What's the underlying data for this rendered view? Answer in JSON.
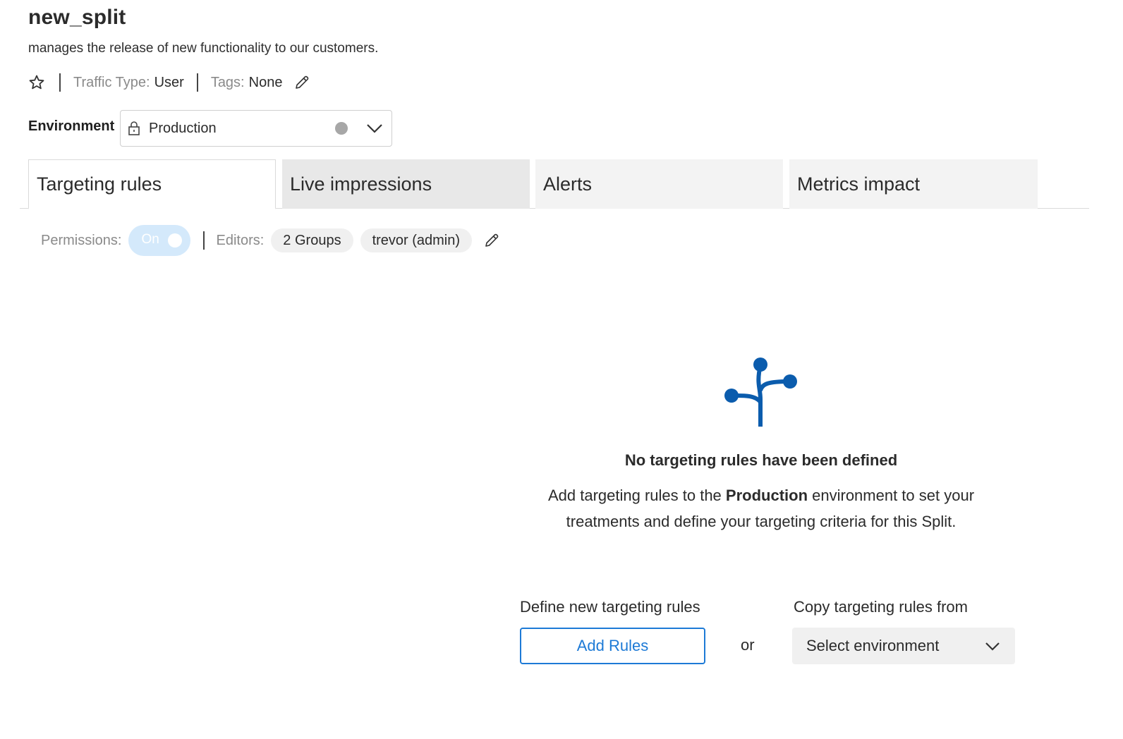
{
  "split": {
    "name": "new_split",
    "description": "manages the release of new functionality to our customers."
  },
  "meta": {
    "traffic_type_label": "Traffic Type:",
    "traffic_type_value": "User",
    "tags_label": "Tags:",
    "tags_value": "None"
  },
  "environment": {
    "label": "Environment",
    "selected": "Production"
  },
  "tabs": [
    {
      "label": "Targeting rules",
      "active": true
    },
    {
      "label": "Live impressions",
      "active": false
    },
    {
      "label": "Alerts",
      "active": false
    },
    {
      "label": "Metrics impact",
      "active": false
    }
  ],
  "permissions": {
    "label": "Permissions:",
    "toggle_text": "On",
    "editors_label": "Editors:",
    "editors": [
      "2 Groups",
      "trevor (admin)"
    ]
  },
  "empty_state": {
    "title": "No targeting rules have been defined",
    "desc_prefix": "Add targeting rules to the ",
    "desc_env": "Production",
    "desc_suffix": " environment to set your treatments and define your targeting criteria for this Split."
  },
  "actions": {
    "define_label": "Define new targeting rules",
    "add_button": "Add Rules",
    "or": "or",
    "copy_label": "Copy targeting rules from",
    "select_placeholder": "Select environment"
  },
  "colors": {
    "accent": "#1d7ad6",
    "icon_blue": "#0b5cad",
    "toggle_bg": "#d4e9fb"
  }
}
